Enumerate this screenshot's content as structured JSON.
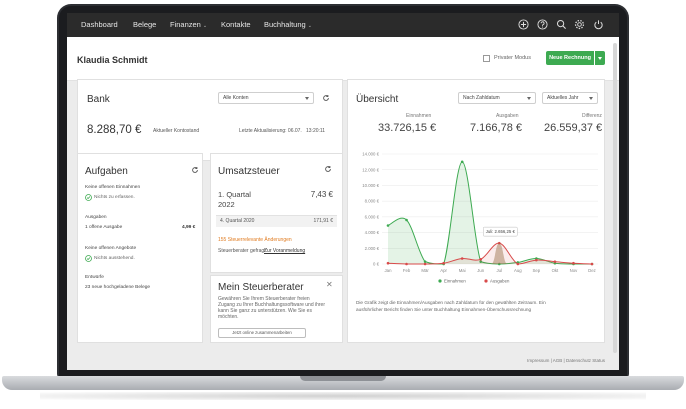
{
  "nav": {
    "items": [
      "Dashboard",
      "Belege",
      "Finanzen",
      "Kontakte",
      "Buchhaltung"
    ],
    "icons": [
      "plus-icon",
      "help-icon",
      "search-icon",
      "gear-icon",
      "power-icon"
    ]
  },
  "header": {
    "user_name": "Klaudia Schmidt",
    "private_mode_label": "Privater Modus",
    "new_invoice_label": "Neue Rechnung"
  },
  "bank": {
    "title": "Bank",
    "account_select": "Alle Konten",
    "balance": "8.288,70 €",
    "balance_label": "Aktueller Kontostand",
    "last_update_label": "Letzte Aktualisierung: 06.07.",
    "last_update_time": "13:20:11"
  },
  "tasks": {
    "title": "Aufgaben",
    "income_heading": "Keine offenen Einnahmen",
    "income_check": "Nichts zu erfassen.",
    "expenses_heading": "Ausgaben",
    "expenses_item": "1 offene Ausgabe",
    "expenses_amount": "4,99 €",
    "offers_heading": "Keine offenen Angebote",
    "offers_check": "Nichts ausstehend.",
    "drafts_heading": "Entwürfe",
    "drafts_item": "23 neue hochgeladene Belege"
  },
  "vat": {
    "title": "Umsatzsteuer",
    "period1": "1. Quartal",
    "period1_year": "2022",
    "amount1": "7,43 €",
    "period2": "4. Quartal 2020",
    "amount2": "171,91 €",
    "changes_link": "155 Steuerrelevante Änderungen",
    "advisor_prompt": "Steuerberater gefragt:",
    "advisor_link": "Zur Voranmeldung"
  },
  "advisor": {
    "title": "Mein Steuerberater",
    "text_line1": "Gewähren Sie Ihrem Steuerberater freien",
    "text_line2": "Zugang zu Ihrer Buchhaltungssoftware und ihrer",
    "text_line3": "kann Sie ganz zu unterstützen. Wie Sie es",
    "text_line4": "möchten.",
    "button_label": "Jetzt online zusammenarbeiten"
  },
  "overview": {
    "title": "Übersicht",
    "range_select": "Nach Zahldatum",
    "year_select": "Aktuelles Jahr",
    "income_label": "Einnahmen",
    "income_value": "33.726,15 €",
    "expenses_label": "Ausgaben",
    "expenses_value": "7.166,78 €",
    "diff_label": "Differenz",
    "diff_value": "26.559,37 €",
    "tooltip": "Juli: 2.656,25 €",
    "note_line1": "Die Grafik zeigt die Einnahmen/Ausgaben nach Zahldatum für den gewählten Zeitraum. Ein",
    "note_line2": "ausführlicher Bericht finden Sie unter Buchhaltung Einnahmen-Überschussrechnung"
  },
  "footer": {
    "links": "Impressum | AGB | Datenschutz Status"
  },
  "colors": {
    "income": "#3daa51",
    "expenses": "#d84a4a",
    "accent": "#3daa51",
    "nav_bg": "#2b2b2b"
  },
  "chart_data": {
    "type": "area",
    "categories": [
      "Jan",
      "Feb",
      "Mär",
      "Apr",
      "Mai",
      "Jun",
      "Jul",
      "Aug",
      "Sep",
      "Okt",
      "Nov",
      "Dez"
    ],
    "y_ticks": [
      "0 €",
      "2.000 €",
      "4.000 €",
      "6.000 €",
      "8.000 €",
      "10.000 €",
      "12.000 €",
      "14.000 €"
    ],
    "ylim": [
      0,
      14000
    ],
    "series": [
      {
        "name": "Einnahmen",
        "values": [
          4900,
          5600,
          300,
          0,
          13000,
          300,
          0,
          200,
          700,
          100,
          0,
          0
        ]
      },
      {
        "name": "Ausgaben",
        "values": [
          100,
          0,
          0,
          100,
          700,
          600,
          2656,
          0,
          500,
          300,
          100,
          0
        ]
      }
    ],
    "legend": "bottom"
  }
}
